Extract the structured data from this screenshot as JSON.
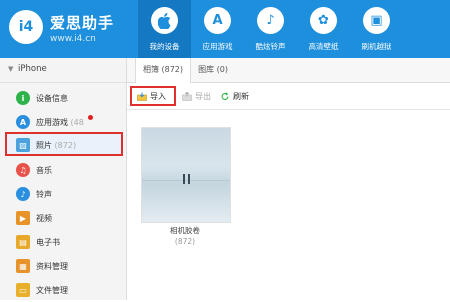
{
  "app": {
    "logo_mark": "i4",
    "name": "爱思助手",
    "url": "www.i4.cn"
  },
  "nav": [
    {
      "label": "我的设备",
      "icon": "apple-icon",
      "glyph": ""
    },
    {
      "label": "应用游戏",
      "icon": "app-store-icon",
      "glyph": "A"
    },
    {
      "label": "酷炫铃声",
      "icon": "bell-icon",
      "glyph": "♪"
    },
    {
      "label": "高清壁纸",
      "icon": "flower-icon",
      "glyph": "✿"
    },
    {
      "label": "刷机越狱",
      "icon": "box-icon",
      "glyph": "▣"
    }
  ],
  "sidebar": {
    "device": "iPhone",
    "items": [
      {
        "label": "设备信息",
        "count": "",
        "icon": "info-icon",
        "color": "#2db34a",
        "glyph": "i"
      },
      {
        "label": "应用游戏",
        "count": "(48",
        "icon": "apps-icon",
        "color": "#2a8fe0",
        "glyph": "A"
      },
      {
        "label": "照片",
        "count": "(872)",
        "icon": "photo-icon",
        "color": "#4aa3df",
        "glyph": "▨"
      },
      {
        "label": "音乐",
        "count": "",
        "icon": "music-icon",
        "color": "#e8524a",
        "glyph": "♫"
      },
      {
        "label": "铃声",
        "count": "",
        "icon": "bell-icon",
        "color": "#2a8fe0",
        "glyph": "♪"
      },
      {
        "label": "视频",
        "count": "",
        "icon": "video-icon",
        "color": "#e8932a",
        "glyph": "▶"
      },
      {
        "label": "电子书",
        "count": "",
        "icon": "book-icon",
        "color": "#e8a82a",
        "glyph": "▤"
      },
      {
        "label": "资料管理",
        "count": "",
        "icon": "data-icon",
        "color": "#e8932a",
        "glyph": "▦"
      },
      {
        "label": "文件管理",
        "count": "",
        "icon": "folder-icon",
        "color": "#e8b02a",
        "glyph": "▭"
      }
    ]
  },
  "tabs": [
    {
      "label": "相簿 (872)"
    },
    {
      "label": "图库 (0)"
    }
  ],
  "toolbar": {
    "import_label": "导入",
    "export_label": "导出",
    "refresh_label": "刷新"
  },
  "album": {
    "title": "相机胶卷",
    "count": "(872)"
  }
}
